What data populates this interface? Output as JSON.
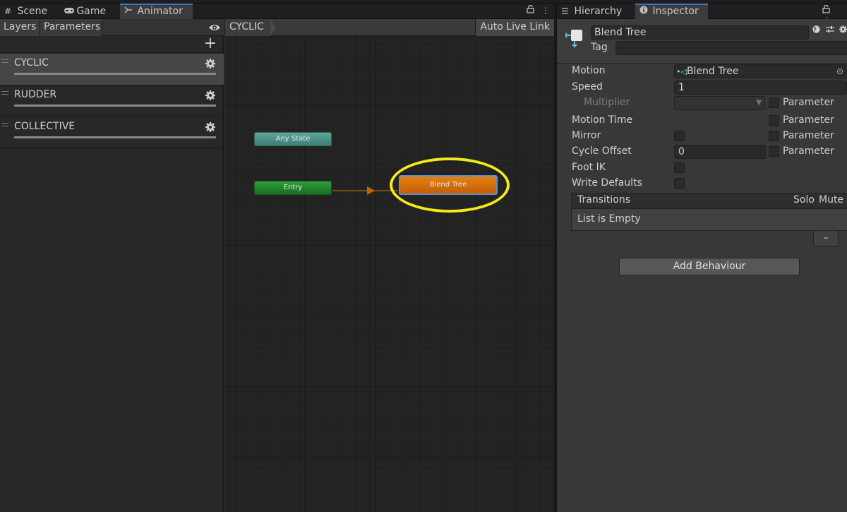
{
  "animator_tabs": [
    {
      "label": "Scene",
      "icon": "grid-icon"
    },
    {
      "label": "Game",
      "icon": "gamepad-icon"
    },
    {
      "label": "Animator",
      "icon": "animator-icon"
    }
  ],
  "left_panel": {
    "tabs": [
      "Layers",
      "Parameters"
    ],
    "layers": [
      {
        "name": "CYCLIC",
        "selected": true
      },
      {
        "name": "RUDDER",
        "selected": false
      },
      {
        "name": "COLLECTIVE",
        "selected": false
      }
    ]
  },
  "graph": {
    "breadcrumb": "CYCLIC",
    "live_link_label": "Auto Live Link",
    "nodes": {
      "any_state": "Any State",
      "entry": "Entry",
      "blend_tree": "Blend Tree"
    },
    "colors": {
      "any_state": "#4e938a",
      "entry": "#23852d",
      "blend_tree": "#d86f0b",
      "highlight": "#f2ea1a",
      "selection": "#5e91c8"
    }
  },
  "inspector_tabs": [
    {
      "label": "Hierarchy",
      "icon": "list-icon"
    },
    {
      "label": "Inspector",
      "icon": "info-icon"
    }
  ],
  "inspector": {
    "object_name": "Blend Tree",
    "tag_label": "Tag",
    "tag_value": "",
    "motion": {
      "label": "Motion",
      "value": "Blend Tree"
    },
    "speed": {
      "label": "Speed",
      "value": "1"
    },
    "multiplier": {
      "label": "Multiplier",
      "param": "Parameter"
    },
    "motion_time": {
      "label": "Motion Time",
      "param": "Parameter"
    },
    "mirror": {
      "label": "Mirror",
      "param": "Parameter"
    },
    "cycle_offset": {
      "label": "Cycle Offset",
      "value": "0",
      "param": "Parameter"
    },
    "foot_ik": {
      "label": "Foot IK"
    },
    "write_defaults": {
      "label": "Write Defaults"
    },
    "transitions": {
      "header": "Transitions",
      "solo": "Solo",
      "mute": "Mute",
      "empty_text": "List is Empty",
      "remove_label": "–"
    },
    "add_behaviour_label": "Add Behaviour"
  }
}
